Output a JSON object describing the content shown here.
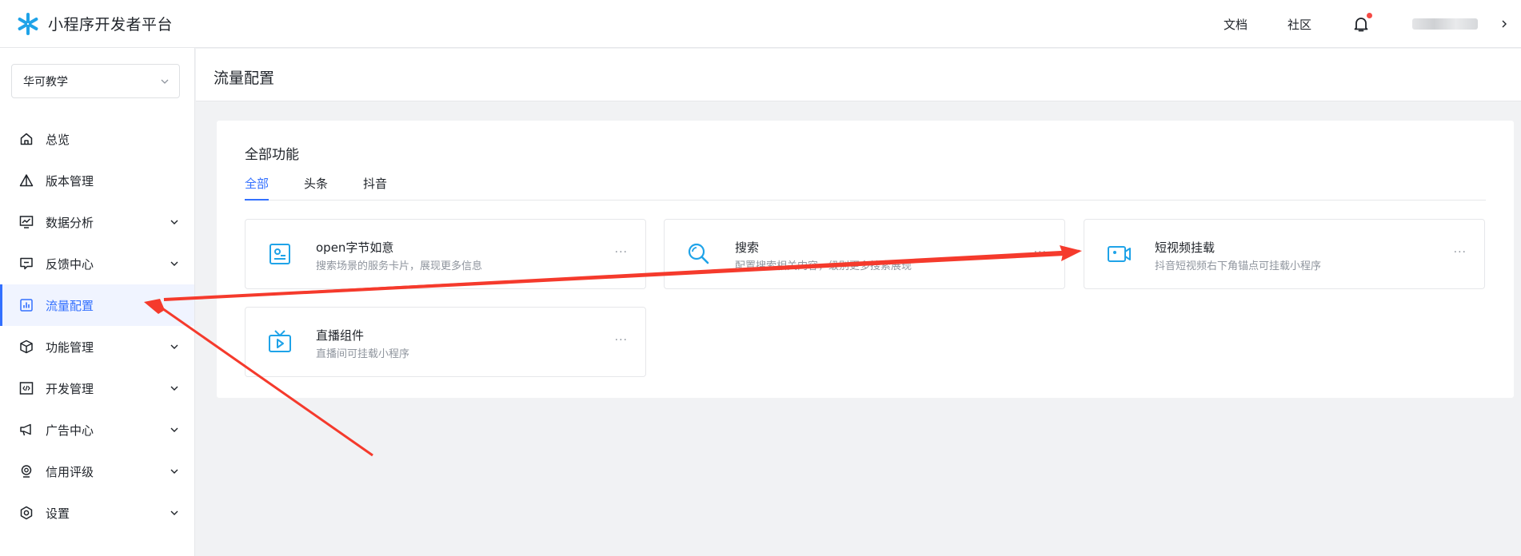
{
  "header": {
    "logo_text": "小程序开发者平台",
    "links": [
      "文档",
      "社区"
    ],
    "icons": {
      "logo": "asterisk-logo-icon",
      "bell": "bell-icon"
    },
    "colors": {
      "brand": "#1fa3e8",
      "accent": "#3370ff",
      "notification_dot": "#f54a45"
    }
  },
  "sidebar": {
    "app_selector": "华可教学",
    "items": [
      {
        "label": "总览",
        "icon": "home-icon",
        "expandable": false
      },
      {
        "label": "版本管理",
        "icon": "warning-triangle-icon",
        "expandable": false
      },
      {
        "label": "数据分析",
        "icon": "monitor-chart-icon",
        "expandable": true
      },
      {
        "label": "反馈中心",
        "icon": "feedback-icon",
        "expandable": true
      },
      {
        "label": "流量配置",
        "icon": "bar-chart-icon",
        "expandable": false,
        "active": true
      },
      {
        "label": "功能管理",
        "icon": "cube-icon",
        "expandable": true
      },
      {
        "label": "开发管理",
        "icon": "code-icon",
        "expandable": true
      },
      {
        "label": "广告中心",
        "icon": "megaphone-icon",
        "expandable": true
      },
      {
        "label": "信用评级",
        "icon": "badge-icon",
        "expandable": true
      },
      {
        "label": "设置",
        "icon": "gear-icon",
        "expandable": true
      }
    ]
  },
  "main": {
    "page_title": "流量配置",
    "section_title": "全部功能",
    "tabs": [
      {
        "label": "全部",
        "active": true
      },
      {
        "label": "头条",
        "active": false
      },
      {
        "label": "抖音",
        "active": false
      }
    ],
    "features": [
      {
        "title": "open字节如意",
        "desc": "搜索场景的服务卡片，展现更多信息",
        "icon": "service-card-icon",
        "more": "···"
      },
      {
        "title": "搜索",
        "desc": "配置搜索相关内容，级别更多搜索展现",
        "icon": "search-icon",
        "more": "···"
      },
      {
        "title": "短视频挂载",
        "desc": "抖音短视频右下角锚点可挂载小程序",
        "icon": "video-camera-icon",
        "more": "···"
      },
      {
        "title": "直播组件",
        "desc": "直播间可挂载小程序",
        "icon": "live-tv-icon",
        "more": "···"
      }
    ]
  },
  "annotations": {
    "arrow_color": "#f53a2c"
  }
}
